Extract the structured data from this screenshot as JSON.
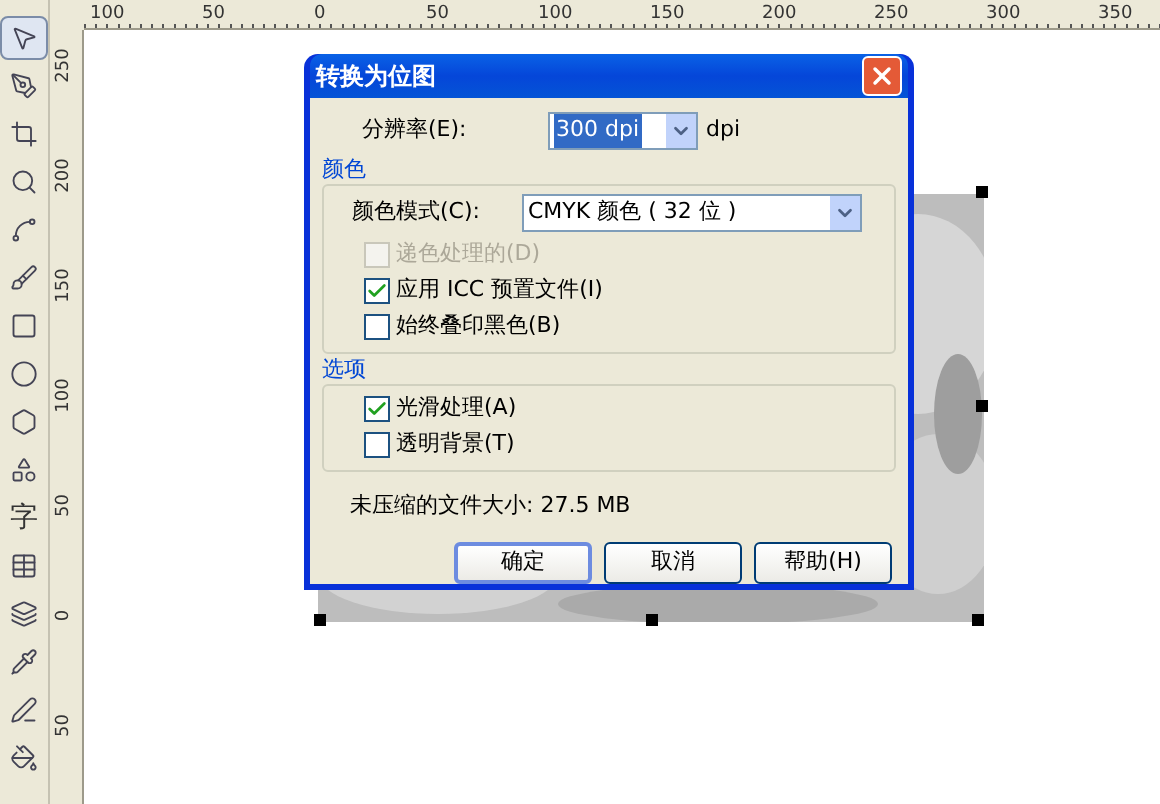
{
  "tools": [
    {
      "kind": "pointer",
      "selected": true
    },
    {
      "kind": "shape",
      "selected": false
    },
    {
      "kind": "crop",
      "selected": false
    },
    {
      "kind": "zoom",
      "selected": false
    },
    {
      "kind": "freehand",
      "selected": false
    },
    {
      "kind": "smart",
      "selected": false
    },
    {
      "kind": "rectangle",
      "selected": false
    },
    {
      "kind": "ellipse",
      "selected": false
    },
    {
      "kind": "polygon",
      "selected": false
    },
    {
      "kind": "basic-shapes",
      "selected": false
    },
    {
      "kind": "text",
      "glyph": "字",
      "selected": false
    },
    {
      "kind": "table",
      "selected": false
    },
    {
      "kind": "interactive",
      "selected": false
    },
    {
      "kind": "eyedropper",
      "selected": false
    },
    {
      "kind": "outline",
      "selected": false
    },
    {
      "kind": "fill",
      "selected": false
    }
  ],
  "top_ruler": [
    "100",
    "50",
    "0",
    "50",
    "100",
    "150",
    "200",
    "250",
    "300",
    "350"
  ],
  "left_ruler": [
    "250",
    "200",
    "150",
    "100",
    "50",
    "0",
    "50"
  ],
  "dialog": {
    "title": "转换为位图",
    "resolution": {
      "label": "分辨率(E):",
      "value": "300 dpi",
      "unit": "dpi"
    },
    "groups": [
      {
        "title": "颜色",
        "dropdown": {
          "label": "颜色模式(C):",
          "value": "CMYK 颜色 ( 32 位 )"
        },
        "checkboxes": [
          {
            "label": "递色处理的(D)",
            "checked": false,
            "disabled": true
          },
          {
            "label": "应用 ICC 预置文件(I)",
            "checked": true,
            "disabled": false
          },
          {
            "label": "始终叠印黑色(B)",
            "checked": false,
            "disabled": false
          }
        ]
      },
      {
        "title": "选项",
        "checkboxes": [
          {
            "label": "光滑处理(A)",
            "checked": true,
            "disabled": false
          },
          {
            "label": "透明背景(T)",
            "checked": false,
            "disabled": false
          }
        ]
      }
    ],
    "file_size": "未压缩的文件大小: 27.5 MB",
    "buttons": [
      {
        "label": "确定",
        "default": true
      },
      {
        "label": "取消",
        "default": false
      },
      {
        "label": "帮助(H)",
        "default": false
      }
    ]
  }
}
